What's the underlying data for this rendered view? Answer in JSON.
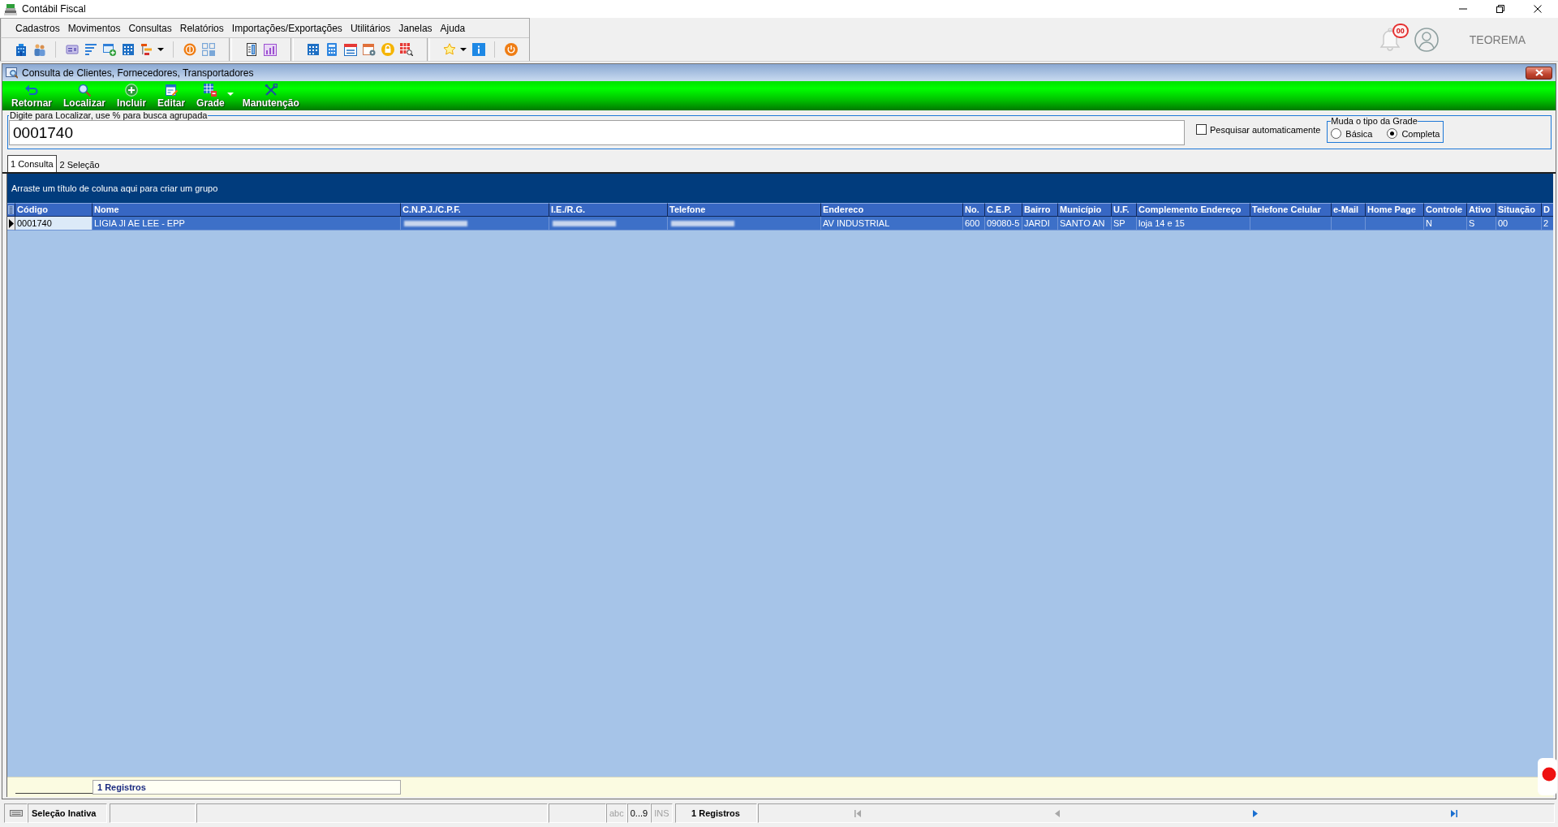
{
  "app": {
    "title": "Contábil Fiscal"
  },
  "menu": [
    "Cadastros",
    "Movimentos",
    "Consultas",
    "Relatórios",
    "Importações/Exportações",
    "Utilitários",
    "Janelas",
    "Ajuda"
  ],
  "header": {
    "notification_count": "00",
    "user": "TEOREMA"
  },
  "window": {
    "title": "Consulta de Clientes, Fornecedores, Transportadores"
  },
  "toolbar": [
    {
      "label": "Retornar",
      "kind": "button"
    },
    {
      "label": "Localizar",
      "kind": "button"
    },
    {
      "label": "Incluir",
      "kind": "button"
    },
    {
      "label": "Editar",
      "kind": "button"
    },
    {
      "label": "Grade",
      "kind": "split"
    },
    {
      "label": "Manutenção",
      "kind": "button"
    }
  ],
  "search": {
    "legend": "Digite para Localizar, use % para busca agrupada",
    "value": "0001740"
  },
  "auto_search": {
    "label": "Pesquisar automaticamente",
    "checked": false
  },
  "grid_type": {
    "legend": "Muda o tipo da Grade",
    "options": [
      {
        "label": "Básica",
        "selected": false
      },
      {
        "label": "Completa",
        "selected": true
      }
    ]
  },
  "tabs": [
    {
      "label": "1 Consulta",
      "selected": true
    },
    {
      "label": "2 Seleção",
      "selected": false
    }
  ],
  "table": {
    "group_hint": "Arraste um título de coluna aqui para criar um grupo",
    "columns": [
      "Código",
      "Nome",
      "C.N.P.J./C.P.F.",
      "I.E./R.G.",
      "Telefone",
      "Endereco",
      "No.",
      "C.E.P.",
      "Bairro",
      "Município",
      "U.F.",
      "Complemento Endereço",
      "Telefone Celular",
      "e-Mail",
      "Home Page",
      "Controle",
      "Ativo",
      "Situação",
      "D"
    ],
    "rows": [
      {
        "selected": true,
        "current": true,
        "cells": [
          {
            "kind": "text",
            "text": "0001740",
            "focused": true
          },
          {
            "kind": "text",
            "text": "LIGIA JI AE LEE - EPP",
            "focused": false
          },
          {
            "kind": "redacted",
            "focused": false
          },
          {
            "kind": "redacted",
            "focused": false
          },
          {
            "kind": "redacted",
            "focused": false
          },
          {
            "kind": "text",
            "text": "AV INDUSTRIAL",
            "focused": false
          },
          {
            "kind": "text",
            "text": "600",
            "focused": false
          },
          {
            "kind": "text",
            "text": "09080-5",
            "focused": false
          },
          {
            "kind": "text",
            "text": "JARDI",
            "focused": false
          },
          {
            "kind": "text",
            "text": "SANTO AN",
            "focused": false
          },
          {
            "kind": "text",
            "text": "SP",
            "focused": false
          },
          {
            "kind": "text",
            "text": "loja 14 e 15",
            "focused": false
          },
          {
            "kind": "empty",
            "focused": false
          },
          {
            "kind": "empty",
            "focused": false
          },
          {
            "kind": "empty",
            "focused": false
          },
          {
            "kind": "text",
            "text": "N",
            "focused": false
          },
          {
            "kind": "text",
            "text": "S",
            "focused": false
          },
          {
            "kind": "text",
            "text": "00",
            "focused": false
          },
          {
            "kind": "text",
            "text": "2",
            "focused": false
          }
        ]
      }
    ],
    "footer_summary": "1 Registros"
  },
  "status_bar": {
    "selection": "Seleção Inativa",
    "indicators": [
      {
        "label": "abc",
        "on": false
      },
      {
        "label": "0...9",
        "on": true
      },
      {
        "label": "INS",
        "on": false
      }
    ],
    "records": "1 Registros",
    "navigation": [
      {
        "kind": "first",
        "disabled": true
      },
      {
        "kind": "previous",
        "disabled": true
      },
      {
        "kind": "next",
        "disabled": false
      },
      {
        "kind": "last",
        "disabled": false
      }
    ]
  }
}
